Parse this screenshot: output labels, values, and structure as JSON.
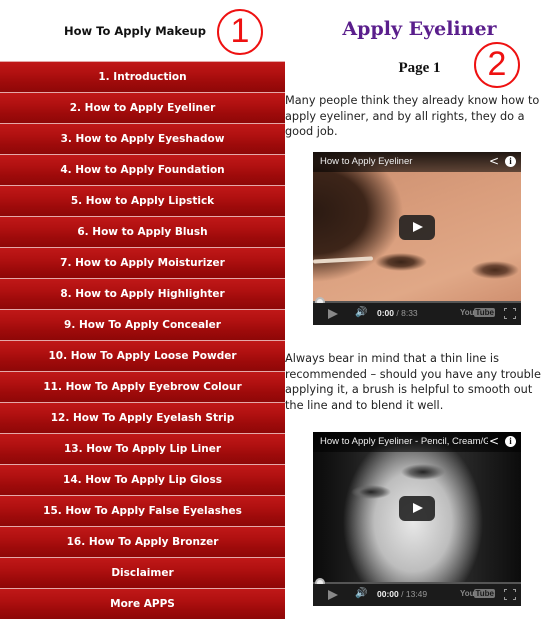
{
  "app": {
    "title": "How To Apply Makeup"
  },
  "menu": {
    "items": [
      {
        "label": "1. Introduction"
      },
      {
        "label": "2. How to Apply Eyeliner"
      },
      {
        "label": "3. How to Apply Eyeshadow"
      },
      {
        "label": "4. How to Apply Foundation"
      },
      {
        "label": "5. How to Apply Lipstick"
      },
      {
        "label": "6. How to Apply Blush"
      },
      {
        "label": "7. How to Apply Moisturizer"
      },
      {
        "label": "8. How to Apply Highlighter"
      },
      {
        "label": "9. How To Apply Concealer"
      },
      {
        "label": "10. How To Apply Loose Powder"
      },
      {
        "label": "11. How To Apply Eyebrow Colour"
      },
      {
        "label": "12. How To Apply Eyelash Strip"
      },
      {
        "label": "13. How To Apply Lip Liner"
      },
      {
        "label": "14. How To Apply Lip Gloss"
      },
      {
        "label": "15. How To Apply False Eyelashes"
      },
      {
        "label": "16. How To Apply Bronzer"
      },
      {
        "label": "Disclaimer"
      },
      {
        "label": "More APPS"
      }
    ]
  },
  "annotations": {
    "one": "1",
    "two": "2",
    "color": "#ee1111"
  },
  "content": {
    "title": "Apply Eyeliner",
    "subtitle": "Page 1",
    "paragraph_1": "Many people think they already know how to apply eyeliner, and by all rights, they do a good job.",
    "paragraph_2": "Always bear in mind that a thin line is recommended – should you have any trouble applying it, a brush is helpful to smooth out the line and to blend it well.",
    "videos": [
      {
        "title": "How to Apply Eyeliner",
        "current_time": "0:00",
        "duration": "/ 8:33",
        "progress": 0,
        "share_icon": "share-icon",
        "info_icon": "info-icon",
        "info_glyph": "i",
        "brand_you": "You",
        "brand_tube": "Tube"
      },
      {
        "title": "How to Apply Eyeliner - Pencil, Cream/G",
        "current_time": "00:00",
        "duration": "/ 13:49",
        "progress": 0,
        "share_icon": "share-icon",
        "info_icon": "info-icon",
        "info_glyph": "i",
        "brand_you": "You",
        "brand_tube": "Tube"
      }
    ]
  },
  "colors": {
    "menu_red": "#b21111",
    "title_purple": "#5a1e8c",
    "annotation_red": "#ee1111"
  }
}
